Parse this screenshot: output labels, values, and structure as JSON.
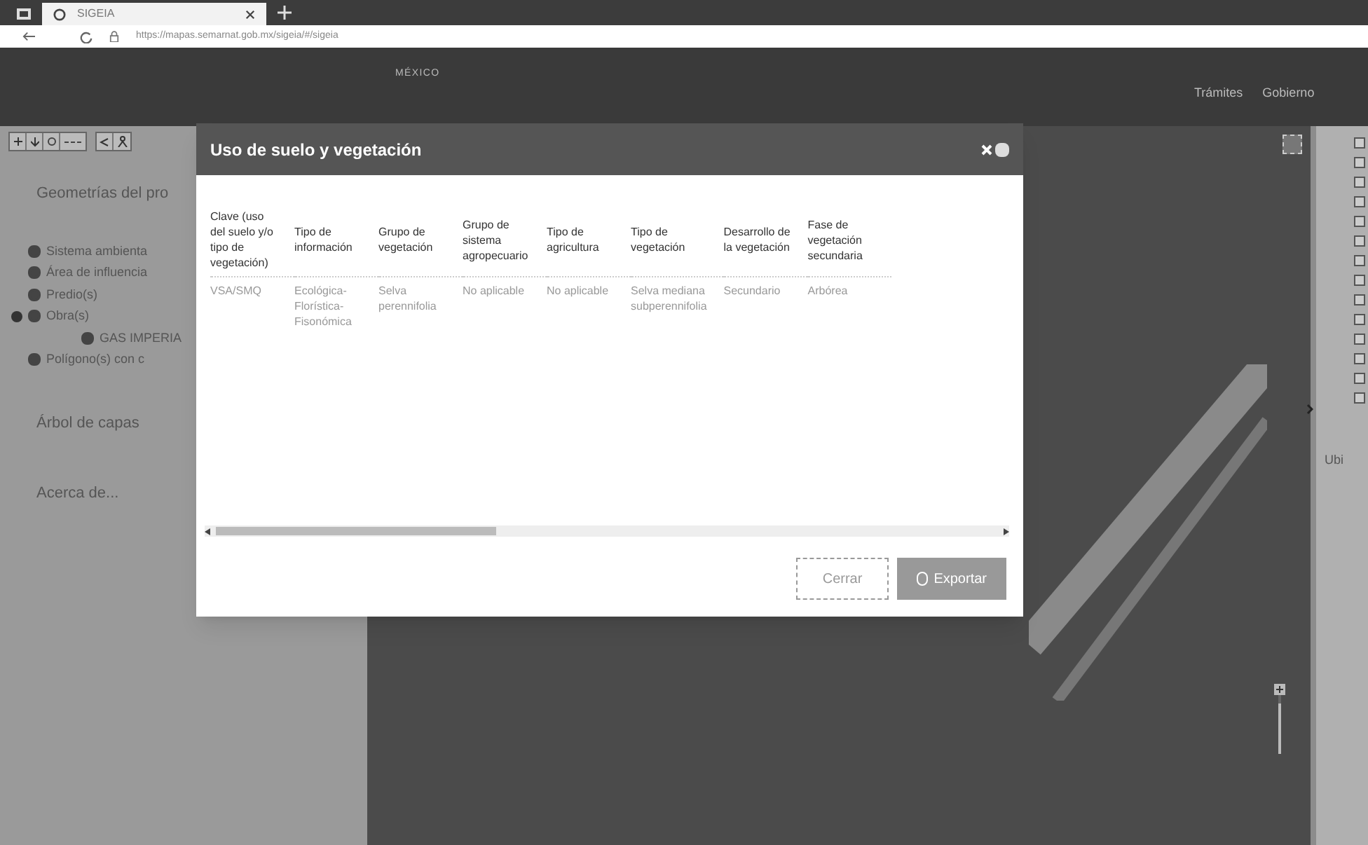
{
  "browser": {
    "tab_title": "SIGEIA",
    "url": "https://mapas.semarnat.gob.mx/sigeia/#/sigeia"
  },
  "header": {
    "logo_text": "MÉXICO",
    "nav": [
      "Trámites",
      "Gobierno"
    ]
  },
  "left_panel": {
    "section_title": "Geometrías del pro",
    "layers": [
      {
        "label": "Sistema ambienta",
        "checked": true
      },
      {
        "label": "Área de influencia",
        "checked": true
      },
      {
        "label": "Predio(s)",
        "checked": true
      },
      {
        "label": "Obra(s)",
        "checked": true,
        "expanded": true,
        "children": [
          {
            "label": "GAS IMPERIA",
            "checked": true
          }
        ]
      },
      {
        "label": "Polígono(s) con c",
        "checked": true
      }
    ],
    "links": [
      "Árbol de capas",
      "Acerca de..."
    ]
  },
  "dialog": {
    "title": "Uso de suelo y vegetación",
    "table": {
      "columns": [
        "Clave (uso del suelo y/o tipo de vegetación)",
        "Tipo de información",
        "Grupo de vegetación",
        "Grupo de sistema agropecuario",
        "Tipo de agricultura",
        "Tipo de vegetación",
        "Desarrollo de la vegetación",
        "Fase de vegetación secundaria"
      ],
      "rows": [
        [
          "VSA/SMQ",
          "Ecológica-Florística-Fisonómica",
          "Selva perennifolia",
          "No aplicable",
          "No aplicable",
          "Selva mediana subperennifolia",
          "Secundario",
          "Arbórea"
        ]
      ]
    },
    "buttons": [
      {
        "label": "Cerrar",
        "kind": "secondary"
      },
      {
        "label": "Exportar",
        "kind": "primary"
      }
    ]
  },
  "map": {
    "zoom_slider": {
      "level": 0.85
    }
  },
  "right_panel": {
    "checkboxes": [
      {
        "checked": false
      },
      {
        "checked": false
      },
      {
        "checked": false
      },
      {
        "checked": false
      },
      {
        "checked": false
      },
      {
        "checked": false
      },
      {
        "checked": false
      },
      {
        "checked": false
      },
      {
        "checked": false
      },
      {
        "checked": false
      },
      {
        "checked": false
      },
      {
        "checked": false
      },
      {
        "checked": false
      },
      {
        "checked": false
      }
    ],
    "label": "Ubi"
  }
}
